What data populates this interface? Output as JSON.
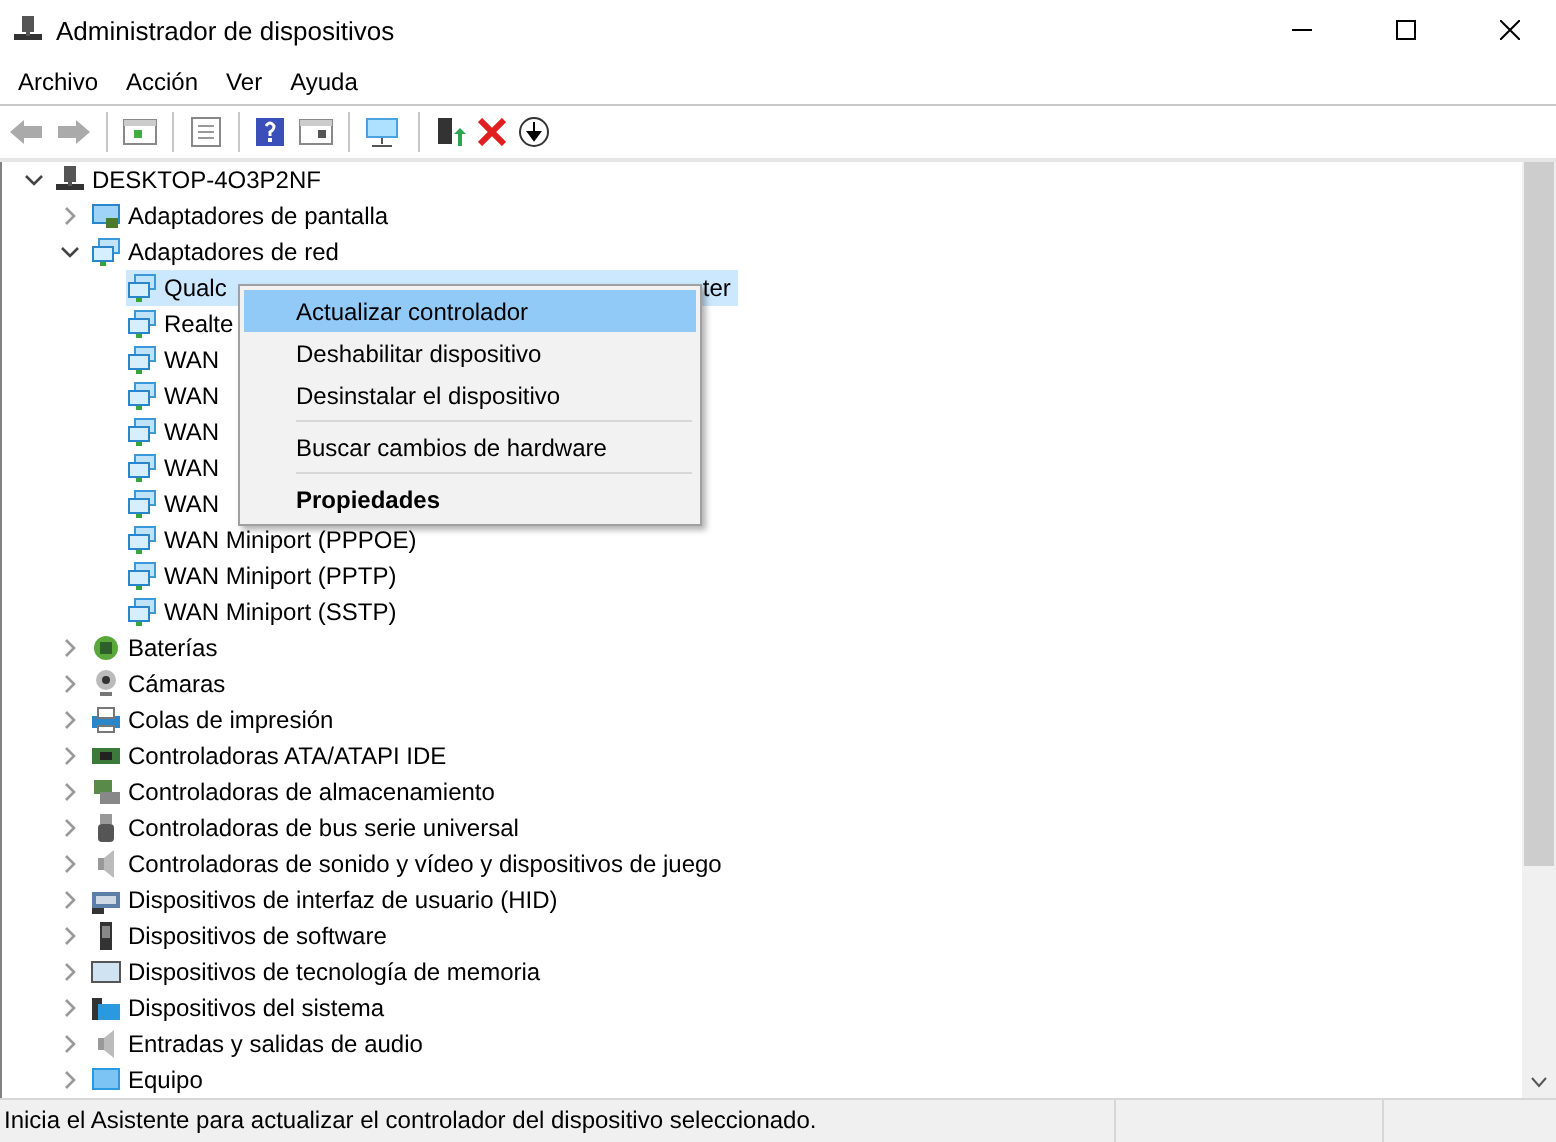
{
  "window": {
    "title": "Administrador de dispositivos"
  },
  "menu_bar": [
    "Archivo",
    "Acción",
    "Ver",
    "Ayuda"
  ],
  "tree": {
    "label": "DESKTOP-4O3P2NF",
    "expanded": true,
    "selected": false,
    "children": [
      {
        "label": "Adaptadores de pantalla",
        "expanded": false,
        "selected": false
      },
      {
        "label": "Adaptadores de red",
        "expanded": true,
        "selected": false,
        "children": [
          {
            "label": "Qualc",
            "trailing": "ter",
            "selected": true
          },
          {
            "label": "Realte",
            "selected": false
          },
          {
            "label": "WAN",
            "selected": false
          },
          {
            "label": "WAN",
            "selected": false
          },
          {
            "label": "WAN",
            "selected": false
          },
          {
            "label": "WAN",
            "selected": false
          },
          {
            "label": "WAN",
            "selected": false
          },
          {
            "label": "WAN Miniport (PPPOE)",
            "selected": false
          },
          {
            "label": "WAN Miniport (PPTP)",
            "selected": false
          },
          {
            "label": "WAN Miniport (SSTP)",
            "selected": false
          }
        ]
      },
      {
        "label": "Baterías",
        "expanded": false,
        "selected": false
      },
      {
        "label": "Cámaras",
        "expanded": false,
        "selected": false
      },
      {
        "label": "Colas de impresión",
        "expanded": false,
        "selected": false
      },
      {
        "label": "Controladoras ATA/ATAPI IDE",
        "expanded": false,
        "selected": false
      },
      {
        "label": "Controladoras de almacenamiento",
        "expanded": false,
        "selected": false
      },
      {
        "label": "Controladoras de bus serie universal",
        "expanded": false,
        "selected": false
      },
      {
        "label": "Controladoras de sonido y vídeo y dispositivos de juego",
        "expanded": false,
        "selected": false
      },
      {
        "label": "Dispositivos de interfaz de usuario (HID)",
        "expanded": false,
        "selected": false
      },
      {
        "label": "Dispositivos de software",
        "expanded": false,
        "selected": false
      },
      {
        "label": "Dispositivos de tecnología de memoria",
        "expanded": false,
        "selected": false
      },
      {
        "label": "Dispositivos del sistema",
        "expanded": false,
        "selected": false
      },
      {
        "label": "Entradas y salidas de audio",
        "expanded": false,
        "selected": false
      },
      {
        "label": "Equipo",
        "expanded": false,
        "selected": false
      }
    ]
  },
  "context_menu": [
    {
      "kind": "item",
      "label": "Actualizar controlador",
      "selected": true,
      "default": false
    },
    {
      "kind": "item",
      "label": "Deshabilitar dispositivo",
      "selected": false,
      "default": false
    },
    {
      "kind": "item",
      "label": "Desinstalar el dispositivo",
      "selected": false,
      "default": false
    },
    {
      "kind": "separator"
    },
    {
      "kind": "item",
      "label": "Buscar cambios de hardware",
      "selected": false,
      "default": false
    },
    {
      "kind": "separator"
    },
    {
      "kind": "item",
      "label": "Propiedades",
      "selected": false,
      "default": true
    }
  ],
  "status_bar": "Inicia el Asistente para actualizar el controlador del dispositivo seleccionado."
}
